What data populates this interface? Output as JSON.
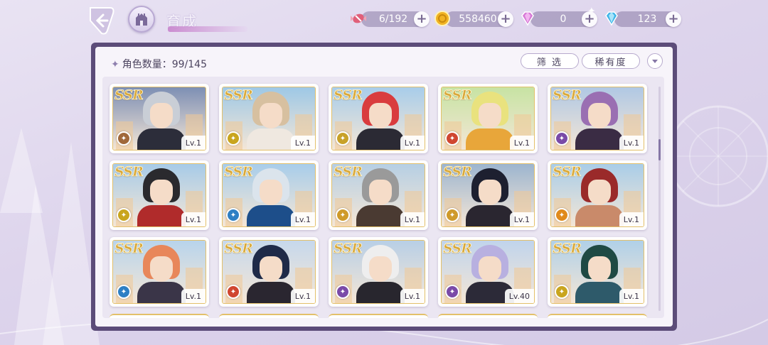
{
  "header": {
    "title": "育成",
    "resources": [
      {
        "icon": "candy-icon",
        "value": "6/192"
      },
      {
        "icon": "gold-coin-icon",
        "value": "558460"
      },
      {
        "icon": "pink-diamond-icon",
        "value": "0"
      },
      {
        "icon": "blue-diamond-icon",
        "value": "123"
      }
    ]
  },
  "panel": {
    "count_label": "角色数量：",
    "count_value": "99/145",
    "filter_label": "筛 选",
    "rarity_label": "稀有度"
  },
  "cards": [
    {
      "rarity": "SSR",
      "level": "Lv.1",
      "element": "earth",
      "element_color": "#a0683a",
      "hair": "#c9ced6",
      "body": "#2c2d3a",
      "sky": "#7d8fb4"
    },
    {
      "rarity": "SSR",
      "level": "Lv.1",
      "element": "wind",
      "element_color": "#c9a51e",
      "hair": "#d7c0a0",
      "body": "#efe8e0",
      "sky": "#9ec8e6"
    },
    {
      "rarity": "SSR",
      "level": "Lv.1",
      "element": "fire",
      "element_color": "#c8a128",
      "hair": "#d93c3e",
      "body": "#2b2a34",
      "sky": "#a8cdea"
    },
    {
      "rarity": "SSR",
      "level": "Lv.1",
      "element": "fire",
      "element_color": "#d04630",
      "hair": "#e9e27e",
      "body": "#e8a63a",
      "sky": "#c7e3a3"
    },
    {
      "rarity": "SSR",
      "level": "Lv.1",
      "element": "shadow",
      "element_color": "#7a4aa8",
      "hair": "#9a6fb2",
      "body": "#3a2c44",
      "sky": "#b0c8e4"
    },
    {
      "rarity": "SSR",
      "level": "Lv.1",
      "element": "wind",
      "element_color": "#c9a51e",
      "hair": "#2a2a2e",
      "body": "#b02b2b",
      "sky": "#a7cbe8"
    },
    {
      "rarity": "SSR",
      "level": "Lv.1",
      "element": "water",
      "element_color": "#2e7fc4",
      "hair": "#dbe4ec",
      "body": "#1d4e8a",
      "sky": "#a8cdea"
    },
    {
      "rarity": "SSR",
      "level": "Lv.1",
      "element": "earth",
      "element_color": "#cf9a2a",
      "hair": "#9a9a9a",
      "body": "#4a3a32",
      "sky": "#b6cfe4"
    },
    {
      "rarity": "SSR",
      "level": "Lv.1",
      "element": "earth",
      "element_color": "#cf9a2a",
      "hair": "#1d2030",
      "body": "#2a2630",
      "sky": "#9cb5cf"
    },
    {
      "rarity": "SSR",
      "level": "Lv.1",
      "element": "fire",
      "element_color": "#e08a1c",
      "hair": "#9a2a2a",
      "body": "#c98a6a",
      "sky": "#a9cde8"
    },
    {
      "rarity": "SSR",
      "level": "Lv.1",
      "element": "water",
      "element_color": "#2e7fc4",
      "hair": "#e8875a",
      "body": "#3a3548",
      "sky": "#b8d4ec"
    },
    {
      "rarity": "SSR",
      "level": "Lv.1",
      "element": "fire",
      "element_color": "#d04630",
      "hair": "#1f2a48",
      "body": "#2a2630",
      "sky": "#c6d8ec"
    },
    {
      "rarity": "SSR",
      "level": "Lv.1",
      "element": "shadow",
      "element_color": "#7a4aa8",
      "hair": "#eeeeee",
      "body": "#28262e",
      "sky": "#b8cfe6"
    },
    {
      "rarity": "SSR",
      "level": "Lv.40",
      "element": "shadow",
      "element_color": "#7a4aa8",
      "hair": "#b8b0e0",
      "body": "#2c2a38",
      "sky": "#c0d4ec"
    },
    {
      "rarity": "SSR",
      "level": "Lv.1",
      "element": "wind",
      "element_color": "#c9a51e",
      "hair": "#1f4a44",
      "body": "#2e5a6a",
      "sky": "#b0d0e8"
    }
  ]
}
